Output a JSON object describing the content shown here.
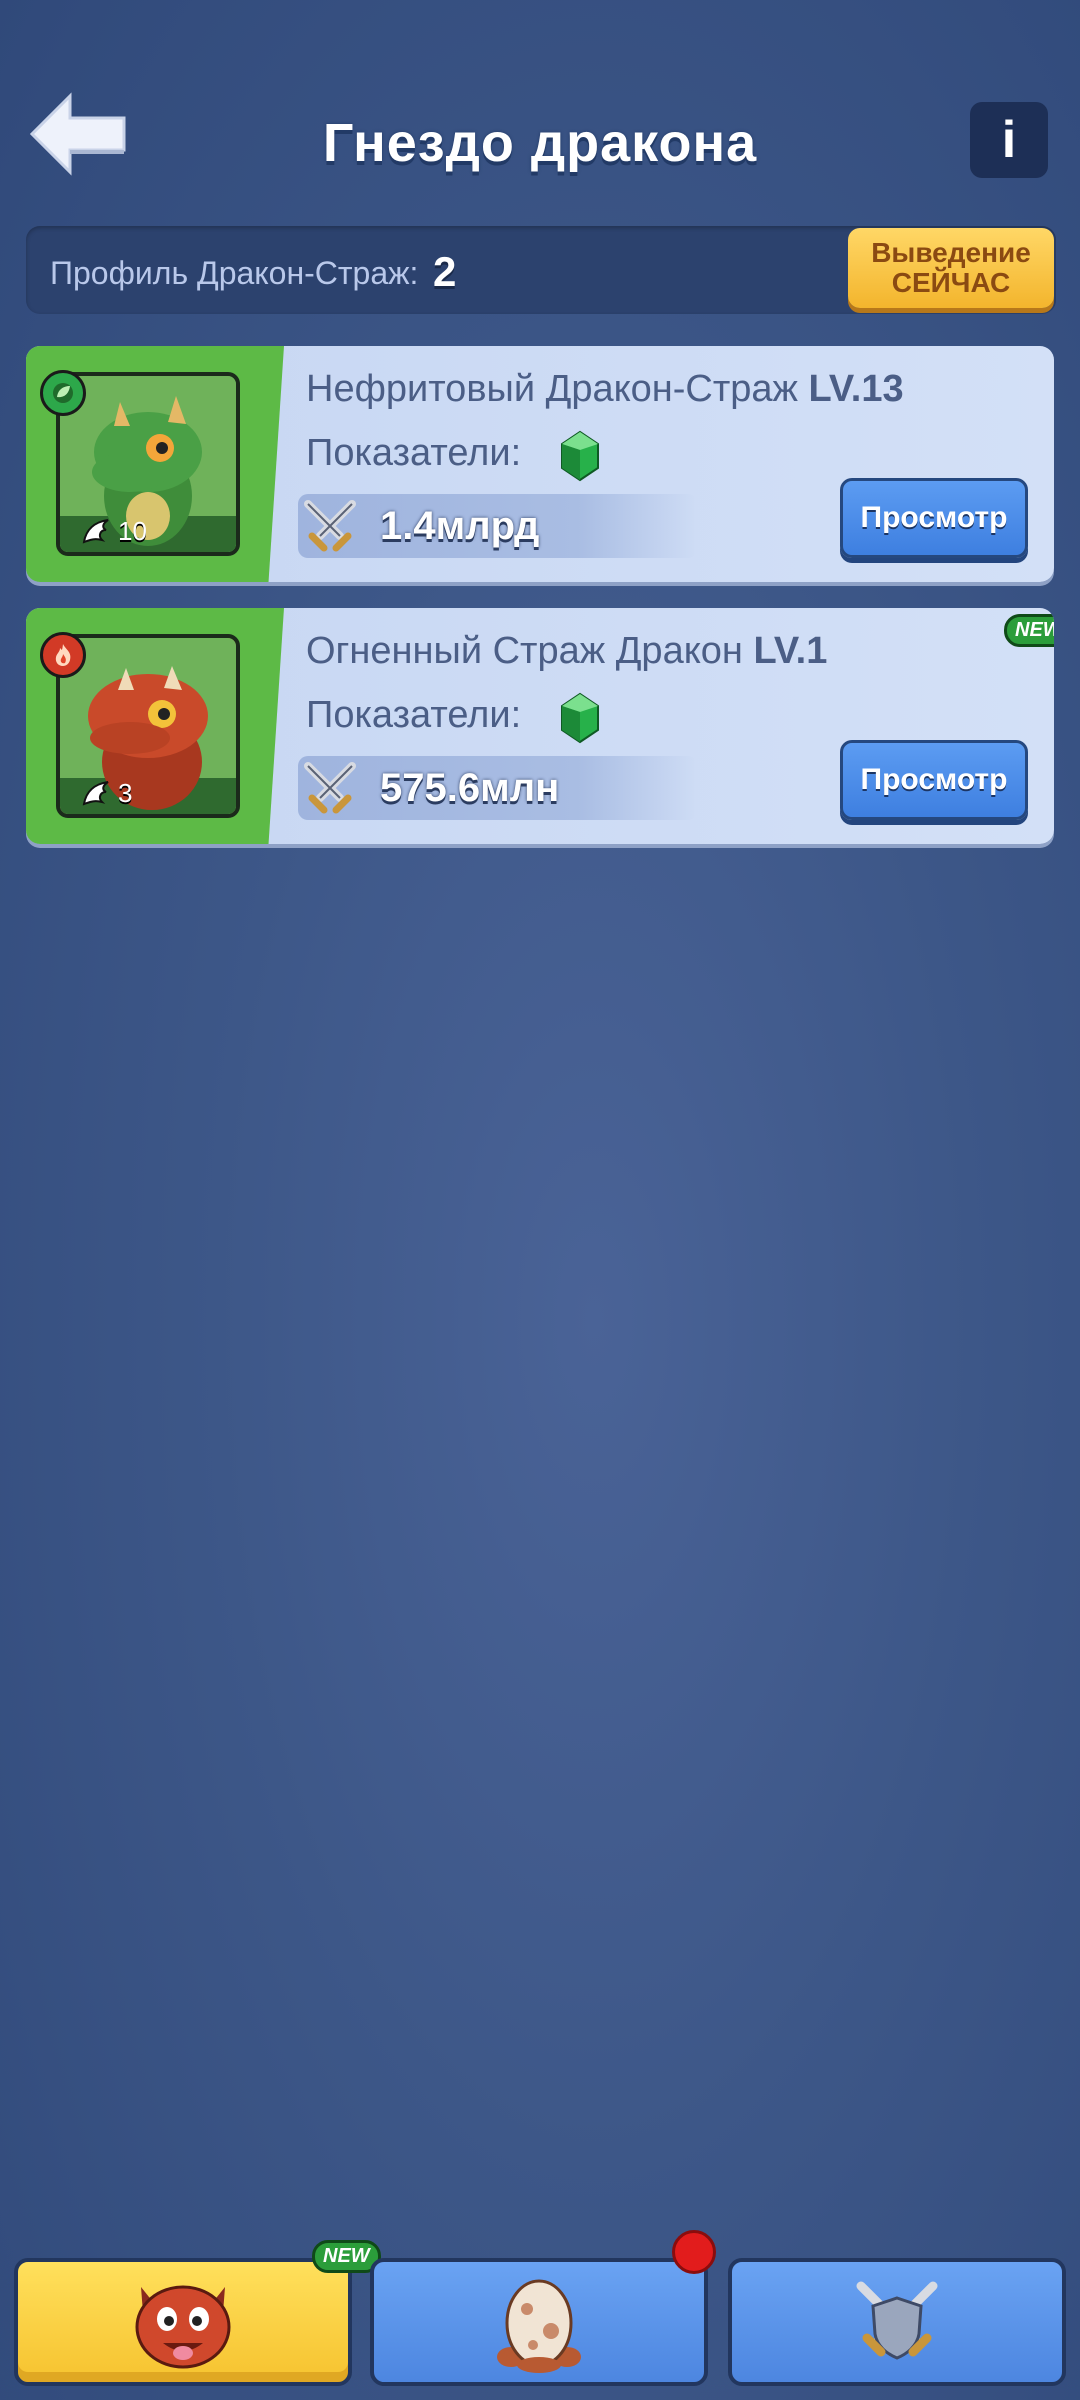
{
  "header": {
    "title": "Гнездо дракона",
    "info_label": "i"
  },
  "profile": {
    "label": "Профиль Дракон-Страж:",
    "count": "2",
    "breed_button_line1": "Выведение",
    "breed_button_line2": "СЕЙЧАС"
  },
  "dragons": [
    {
      "name": "Нефритовый Дракон-Страж",
      "level": "LV.13",
      "stats_label": "Показатели:",
      "stars": "10",
      "power": "1.4млрд",
      "view_label": "Просмотр",
      "element": "leaf-icon"
    },
    {
      "name": "Огненный Страж Дракон",
      "level": "LV.1",
      "stats_label": "Показатели:",
      "stars": "3",
      "power": "575.6млн",
      "view_label": "Просмотр",
      "element": "fire-icon",
      "badge": "NEW"
    }
  ],
  "nav": {
    "tab1_badge": "NEW"
  },
  "colors": {
    "background": "#3d5788",
    "card_green": "#5dba46",
    "breed_button": "#f3b52d",
    "view_button": "#3e7fe0"
  }
}
